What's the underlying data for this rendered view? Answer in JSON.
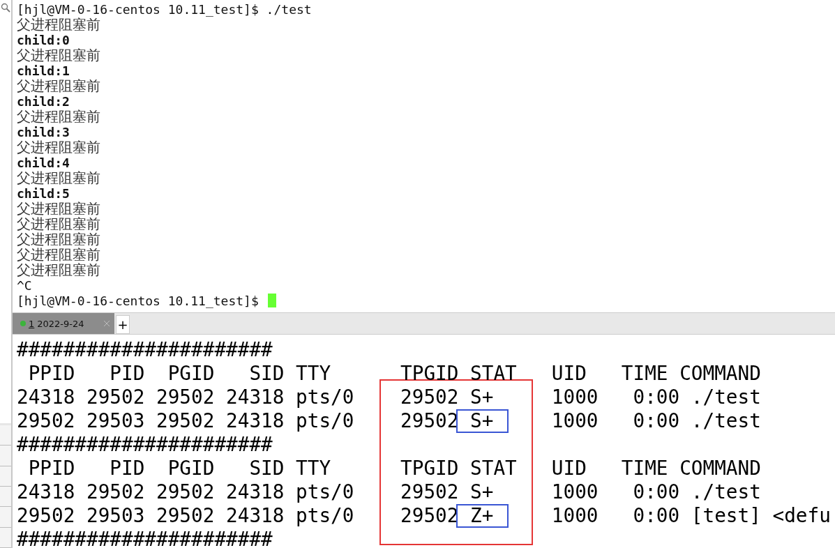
{
  "top_terminal": {
    "lines": [
      {
        "kind": "prompt",
        "text": "[hjl@VM-0-16-centos 10.11_test]$ ./test",
        "cursor": false
      },
      {
        "kind": "cjk",
        "text": "父进程阻塞前"
      },
      {
        "kind": "output",
        "text": "child:0"
      },
      {
        "kind": "cjk",
        "text": "父进程阻塞前"
      },
      {
        "kind": "output",
        "text": "child:1"
      },
      {
        "kind": "cjk",
        "text": "父进程阻塞前"
      },
      {
        "kind": "output",
        "text": "child:2"
      },
      {
        "kind": "cjk",
        "text": "父进程阻塞前"
      },
      {
        "kind": "output",
        "text": "child:3"
      },
      {
        "kind": "cjk",
        "text": "父进程阻塞前"
      },
      {
        "kind": "output",
        "text": "child:4"
      },
      {
        "kind": "cjk",
        "text": "父进程阻塞前"
      },
      {
        "kind": "output",
        "text": "child:5"
      },
      {
        "kind": "cjk",
        "text": "父进程阻塞前"
      },
      {
        "kind": "cjk",
        "text": "父进程阻塞前"
      },
      {
        "kind": "cjk",
        "text": "父进程阻塞前"
      },
      {
        "kind": "cjk",
        "text": "父进程阻塞前"
      },
      {
        "kind": "cjk",
        "text": "父进程阻塞前"
      },
      {
        "kind": "prompt",
        "text": "^C",
        "cursor": false
      },
      {
        "kind": "prompt",
        "text": "[hjl@VM-0-16-centos 10.11_test]$ ",
        "cursor": true
      }
    ]
  },
  "tabs": [
    {
      "number": "1",
      "label": "2022-9-24",
      "selected": true,
      "connected": true
    }
  ],
  "new_tab_button": "+",
  "bottom_terminal": {
    "lines": [
      {
        "text": "######################",
        "boxed": false
      },
      {
        "text": " PPID   PID  PGID   SID TTY      TPGID STAT   UID   TIME COMMAND",
        "boxed": false
      },
      {
        "text": "24318 29502 29502 24318 pts/0    29502 S+     1000   0:00 ./test",
        "boxed": false
      },
      {
        "text": "29502 29503 29502 24318 pts/0    29502 S+     1000   0:00 ./test",
        "boxed": true
      },
      {
        "text": "######################",
        "boxed": false
      },
      {
        "text": " PPID   PID  PGID   SID TTY      TPGID STAT   UID   TIME COMMAND",
        "boxed": false
      },
      {
        "text": "24318 29502 29502 24318 pts/0    29502 S+     1000   0:00 ./test",
        "boxed": false
      },
      {
        "text": "29502 29503 29502 24318 pts/0    29502 Z+     1000   0:00 [test] <defu",
        "boxed": true
      },
      {
        "text": "######################",
        "boxed": false
      }
    ]
  }
}
